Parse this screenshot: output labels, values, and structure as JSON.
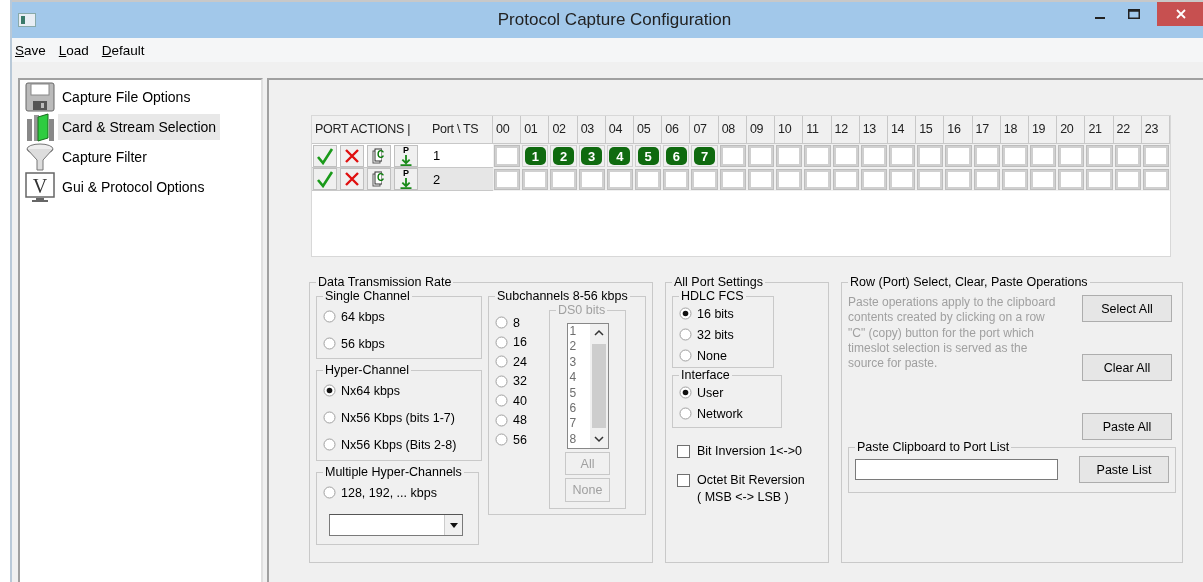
{
  "window": {
    "title": "Protocol Capture Configuration"
  },
  "menu": [
    {
      "label": "Save",
      "underline_first": true
    },
    {
      "label": "Load",
      "underline_first": true
    },
    {
      "label": "Default",
      "underline_first": true
    }
  ],
  "sidebar": {
    "items": [
      {
        "label": "Capture File Options",
        "selected": false
      },
      {
        "label": "Card & Stream Selection",
        "selected": true
      },
      {
        "label": "Capture Filter",
        "selected": false
      },
      {
        "label": "Gui & Protocol Options",
        "icon_label": "V",
        "selected": false
      }
    ]
  },
  "port_grid": {
    "actions_heading": "PORT ACTIONS  |",
    "port_heading": "Port \\ TS",
    "timeslots": [
      "00",
      "01",
      "02",
      "03",
      "04",
      "05",
      "06",
      "07",
      "08",
      "09",
      "10",
      "11",
      "12",
      "13",
      "14",
      "15",
      "16",
      "17",
      "18",
      "19",
      "20",
      "21",
      "22",
      "23"
    ],
    "rows": [
      {
        "port": "1",
        "selected": true,
        "actions": [
          {
            "kind": "check"
          },
          {
            "kind": "cross"
          },
          {
            "kind": "copy",
            "label": "C"
          },
          {
            "kind": "paste",
            "label": "P"
          }
        ],
        "slots": [
          {
            "assigned": false
          },
          {
            "assigned": true,
            "label": "1"
          },
          {
            "assigned": true,
            "label": "2"
          },
          {
            "assigned": true,
            "label": "3"
          },
          {
            "assigned": true,
            "label": "4"
          },
          {
            "assigned": true,
            "label": "5"
          },
          {
            "assigned": true,
            "label": "6"
          },
          {
            "assigned": true,
            "label": "7"
          },
          {
            "assigned": false
          },
          {
            "assigned": false
          },
          {
            "assigned": false
          },
          {
            "assigned": false
          },
          {
            "assigned": false
          },
          {
            "assigned": false
          },
          {
            "assigned": false
          },
          {
            "assigned": false
          },
          {
            "assigned": false
          },
          {
            "assigned": false
          },
          {
            "assigned": false
          },
          {
            "assigned": false
          },
          {
            "assigned": false
          },
          {
            "assigned": false
          },
          {
            "assigned": false
          },
          {
            "assigned": false
          }
        ]
      },
      {
        "port": "2",
        "selected": false,
        "actions": [
          {
            "kind": "check"
          },
          {
            "kind": "cross"
          },
          {
            "kind": "copy",
            "label": "C"
          },
          {
            "kind": "paste",
            "label": "P"
          }
        ],
        "slots": [
          {
            "assigned": false
          },
          {
            "assigned": false
          },
          {
            "assigned": false
          },
          {
            "assigned": false
          },
          {
            "assigned": false
          },
          {
            "assigned": false
          },
          {
            "assigned": false
          },
          {
            "assigned": false
          },
          {
            "assigned": false
          },
          {
            "assigned": false
          },
          {
            "assigned": false
          },
          {
            "assigned": false
          },
          {
            "assigned": false
          },
          {
            "assigned": false
          },
          {
            "assigned": false
          },
          {
            "assigned": false
          },
          {
            "assigned": false
          },
          {
            "assigned": false
          },
          {
            "assigned": false
          },
          {
            "assigned": false
          },
          {
            "assigned": false
          },
          {
            "assigned": false
          },
          {
            "assigned": false
          },
          {
            "assigned": false
          }
        ]
      }
    ]
  },
  "data_rate": {
    "title": "Data Transmission Rate",
    "single_channel": {
      "title": "Single Channel",
      "options": [
        {
          "label": "64 kbps",
          "selected": false
        },
        {
          "label": "56 kbps",
          "selected": false
        }
      ]
    },
    "hyper_channel": {
      "title": "Hyper-Channel",
      "options": [
        {
          "label": "Nx64 kbps",
          "selected": true
        },
        {
          "label": "Nx56 Kbps (bits 1-7)",
          "selected": false
        },
        {
          "label": "Nx56 Kbps (Bits 2-8)",
          "selected": false
        }
      ]
    },
    "multiple_hyper_channels": {
      "title": "Multiple Hyper-Channels",
      "options": [
        {
          "label": "128, 192, ... kbps",
          "selected": false
        }
      ]
    },
    "subchannels": {
      "title": "Subchannels 8-56 kbps",
      "options": [
        {
          "label": "8",
          "selected": false
        },
        {
          "label": "16",
          "selected": false
        },
        {
          "label": "24",
          "selected": false
        },
        {
          "label": "32",
          "selected": false
        },
        {
          "label": "40",
          "selected": false
        },
        {
          "label": "48",
          "selected": false
        },
        {
          "label": "56",
          "selected": false
        }
      ],
      "ds0_bits": {
        "title": "DS0 bits",
        "disabled": true,
        "items": [
          "1",
          "2",
          "3",
          "4",
          "5",
          "6",
          "7",
          "8"
        ],
        "buttons": [
          {
            "label": "All",
            "disabled": true
          },
          {
            "label": "None",
            "disabled": true
          }
        ]
      }
    }
  },
  "all_port_settings": {
    "title": "All Port Settings",
    "hdlc_fcs": {
      "title": "HDLC FCS",
      "options": [
        {
          "label": "16 bits",
          "selected": true
        },
        {
          "label": "32 bits",
          "selected": false
        },
        {
          "label": "None",
          "selected": false
        }
      ]
    },
    "interface": {
      "title": "Interface",
      "options": [
        {
          "label": "User",
          "selected": true
        },
        {
          "label": "Network",
          "selected": false
        }
      ]
    },
    "checkboxes": [
      {
        "label": "Bit Inversion 1<->0",
        "checked": false
      },
      {
        "label": "Octet Bit Reversion\n( MSB <-> LSB )",
        "checked": false
      }
    ]
  },
  "row_operations": {
    "title": "Row (Port) Select, Clear, Paste Operations",
    "hint": "Paste operations apply to the clipboard contents created by clicking on a row \"C\" (copy) button for the port which timeslot selection is served as the source for paste.",
    "buttons": [
      "Select All",
      "Clear All",
      "Paste All"
    ],
    "paste_list": {
      "title": "Paste Clipboard to Port List",
      "button": "Paste List"
    }
  }
}
